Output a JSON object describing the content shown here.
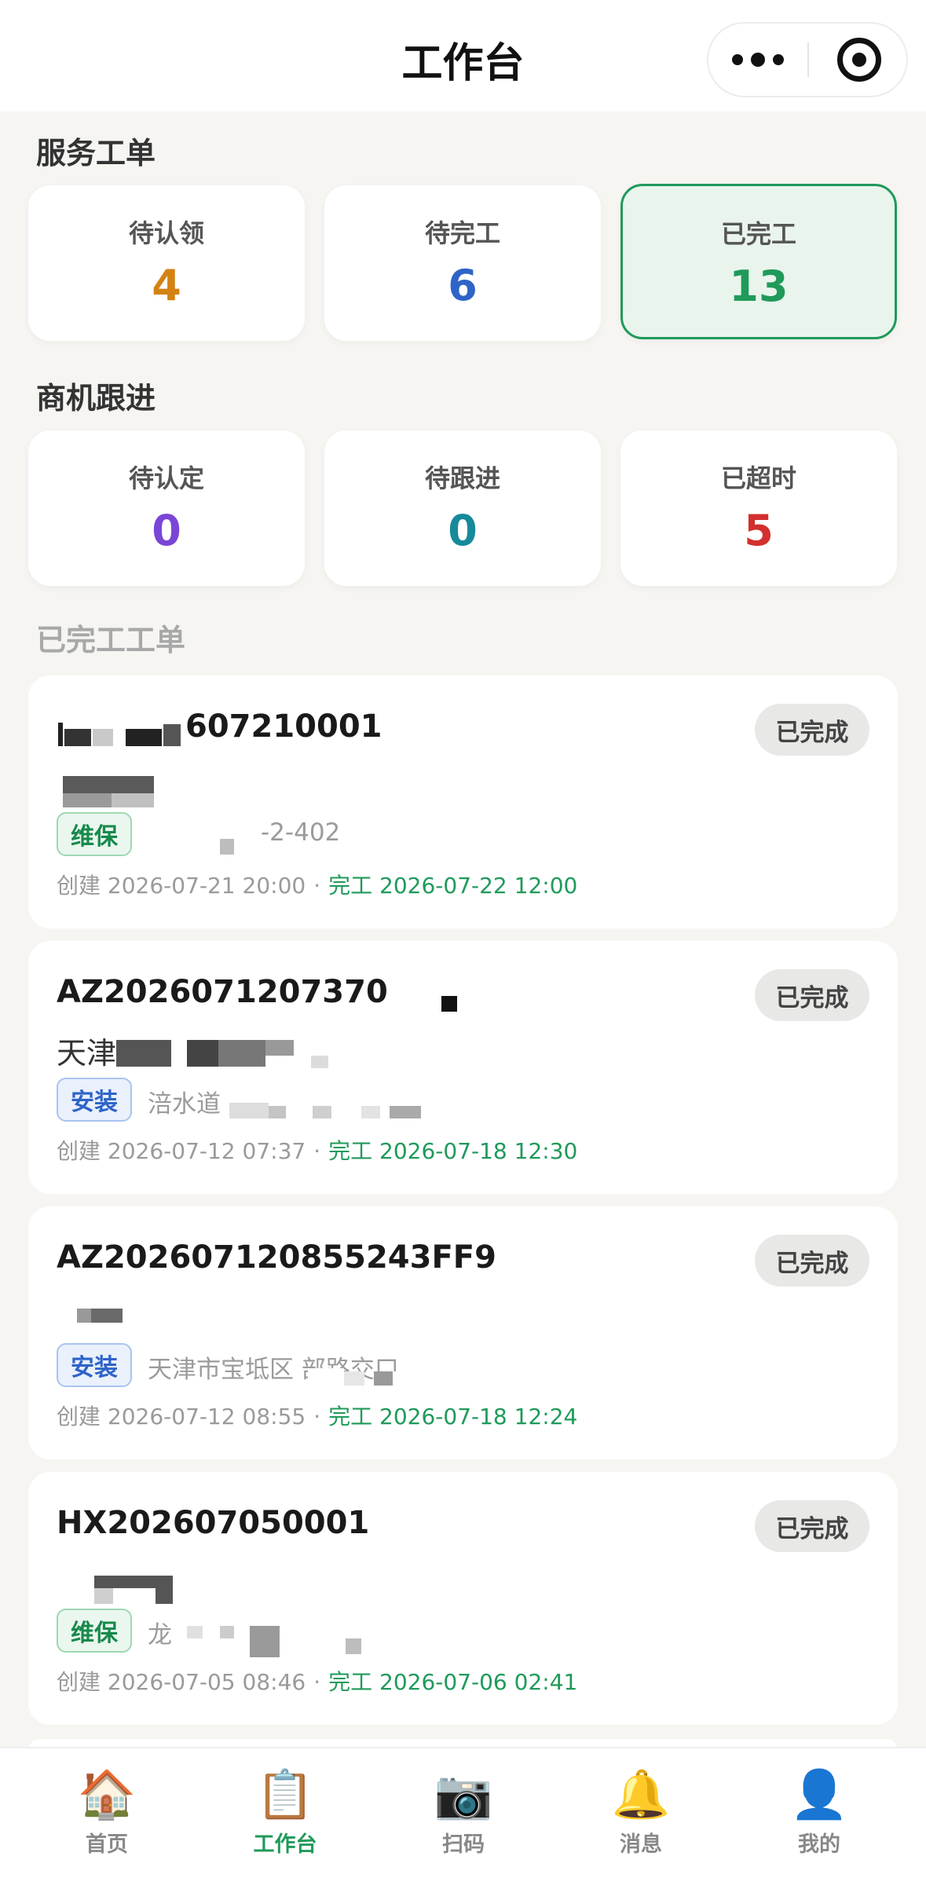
{
  "nav": {
    "title": "工作台"
  },
  "service": {
    "title": "服务工单",
    "cards": [
      {
        "label": "待认领",
        "value": "4",
        "color": "#d38313"
      },
      {
        "label": "待完工",
        "value": "6",
        "color": "#2e64c8"
      },
      {
        "label": "已完工",
        "value": "13",
        "color": "#1f9a5a"
      }
    ]
  },
  "opportunity": {
    "title": "商机跟进",
    "cards": [
      {
        "label": "待认定",
        "value": "0",
        "color": "#7b45d6"
      },
      {
        "label": "待跟进",
        "value": "0",
        "color": "#16899b"
      },
      {
        "label": "已超时",
        "value": "5",
        "color": "#d32f2f"
      }
    ]
  },
  "list": {
    "title": "已完工工单",
    "orders": [
      {
        "no": "607210001",
        "status": "已完成",
        "customer": "",
        "tag": "维保",
        "address": "-2-402",
        "created": "创建 2026-07-21 20:00",
        "separator": "·",
        "completed": "完工 2026-07-22 12:00"
      },
      {
        "no": "AZ2026071207370",
        "status": "已完成",
        "customer": "天津",
        "tag": "安装",
        "address": "涪水道",
        "created": "创建 2026-07-12 07:37",
        "separator": "·",
        "completed": "完工 2026-07-18 12:30"
      },
      {
        "no": "AZ202607120855243FF9",
        "status": "已完成",
        "customer": "",
        "tag": "安装",
        "address": "天津市宝坻区 部路交口",
        "created": "创建 2026-07-12 08:55",
        "separator": "·",
        "completed": "完工 2026-07-18 12:24"
      },
      {
        "no": "HX202607050001",
        "status": "已完成",
        "customer": "",
        "tag": "维保",
        "address": "龙",
        "created": "创建 2026-07-05 08:46",
        "separator": "·",
        "completed": "完工 2026-07-06 02:41"
      }
    ]
  },
  "tabbar": {
    "items": [
      {
        "label": "首页",
        "icon": "🏠",
        "icon_name": "home-icon"
      },
      {
        "label": "工作台",
        "icon": "📋",
        "icon_name": "clipboard-icon"
      },
      {
        "label": "扫码",
        "icon": "📷",
        "icon_name": "camera-icon"
      },
      {
        "label": "消息",
        "icon": "🔔",
        "icon_name": "bell-icon"
      },
      {
        "label": "我的",
        "icon": "👤",
        "icon_name": "user-icon"
      }
    ]
  }
}
